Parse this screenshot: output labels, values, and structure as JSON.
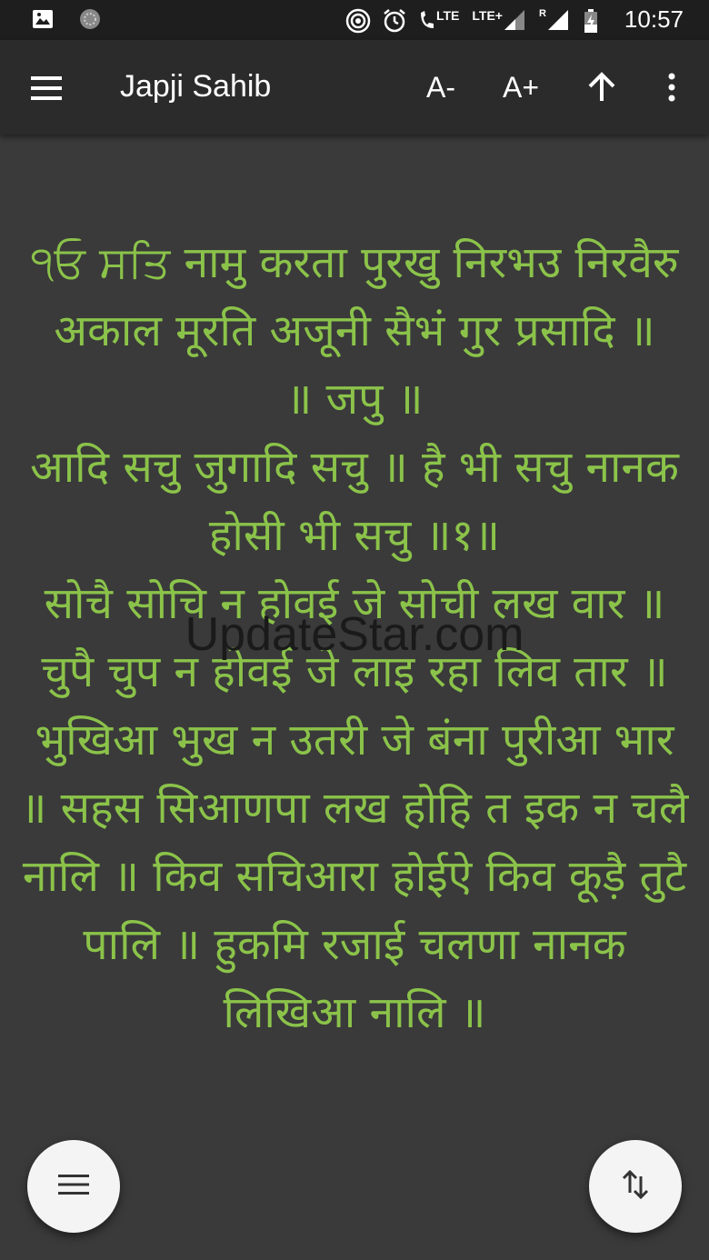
{
  "status_bar": {
    "network_labels": [
      "LTE",
      "LTE+",
      "R"
    ],
    "time": "10:57"
  },
  "app_bar": {
    "title": "Japji Sahib",
    "decrease_font_label": "A-",
    "increase_font_label": "A+",
    "icons": [
      "menu-icon",
      "arrow-up-icon",
      "more-vert-icon"
    ]
  },
  "content": {
    "lines": [
      "੧ਓ ਸਤਿ नामु करता पुरखु निरभउ निरवैरु अकाल मूरति अजूनी सैभं गुर प्रसादि ॥",
      "॥ जपु ॥",
      "आदि सचु जुगादि सचु ॥ है भी सचु नानक होसी भी सचु ॥१॥",
      "सोचै सोचि न होवई जे सोची लख वार ॥ चुपै चुप न होवई जे लाइ रहा लिव तार ॥ भुखिआ भुख न उतरी जे बंना पुरीआ भार ॥ सहस सिआणपा लख होहि त इक न चलै नालि ॥ किव सचिआरा होईऐ किव कूड़ै तुटै पालि ॥ हुकमि रजाई चलणा नानक लिखिआ नालि ॥"
    ]
  },
  "watermark": "UpdateStar.com",
  "colors": {
    "text_accent": "#8bc34a",
    "background": "#3a3a3a",
    "app_bar": "#2b2b2b",
    "status_bar": "#1e1e1e"
  },
  "fabs": {
    "left_icon": "list-menu-icon",
    "right_icon": "swap-vertical-icon"
  }
}
